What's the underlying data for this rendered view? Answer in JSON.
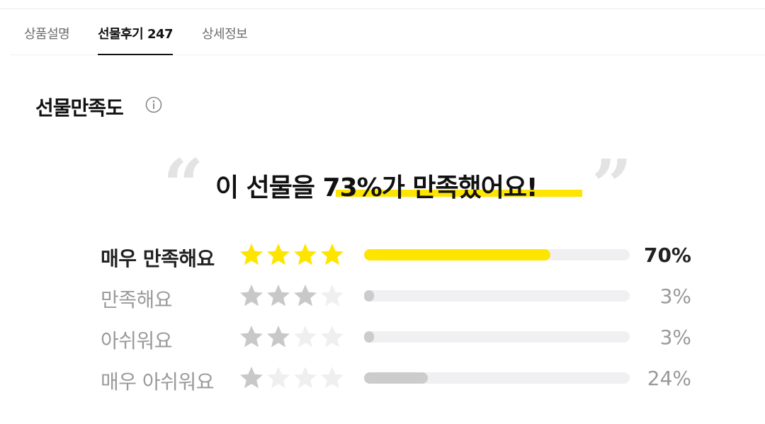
{
  "tabs": [
    {
      "label": "상품설명",
      "active": false
    },
    {
      "label": "선물후기 247",
      "active": true
    },
    {
      "label": "상세정보",
      "active": false
    }
  ],
  "section": {
    "title": "선물만족도",
    "info_icon": "info-icon"
  },
  "headline": {
    "prefix": "이 선물을 ",
    "highlight": "73%가 만족했어요!",
    "quote_open": "“",
    "quote_close": "”"
  },
  "colors": {
    "accent": "#fee500",
    "star_filled_top": "#fee500",
    "star_filled": "#c8c8c8",
    "star_empty": "#efefef",
    "bar_track": "#f0f0f2",
    "bar_gray": "#cccccc"
  },
  "ratings": [
    {
      "label": "매우 만족해요",
      "stars": 4,
      "percent": 70,
      "percent_label": "70%"
    },
    {
      "label": "만족해요",
      "stars": 3,
      "percent": 3,
      "percent_label": "3%"
    },
    {
      "label": "아쉬워요",
      "stars": 2,
      "percent": 3,
      "percent_label": "3%"
    },
    {
      "label": "매우 아쉬워요",
      "stars": 1,
      "percent": 24,
      "percent_label": "24%"
    }
  ]
}
